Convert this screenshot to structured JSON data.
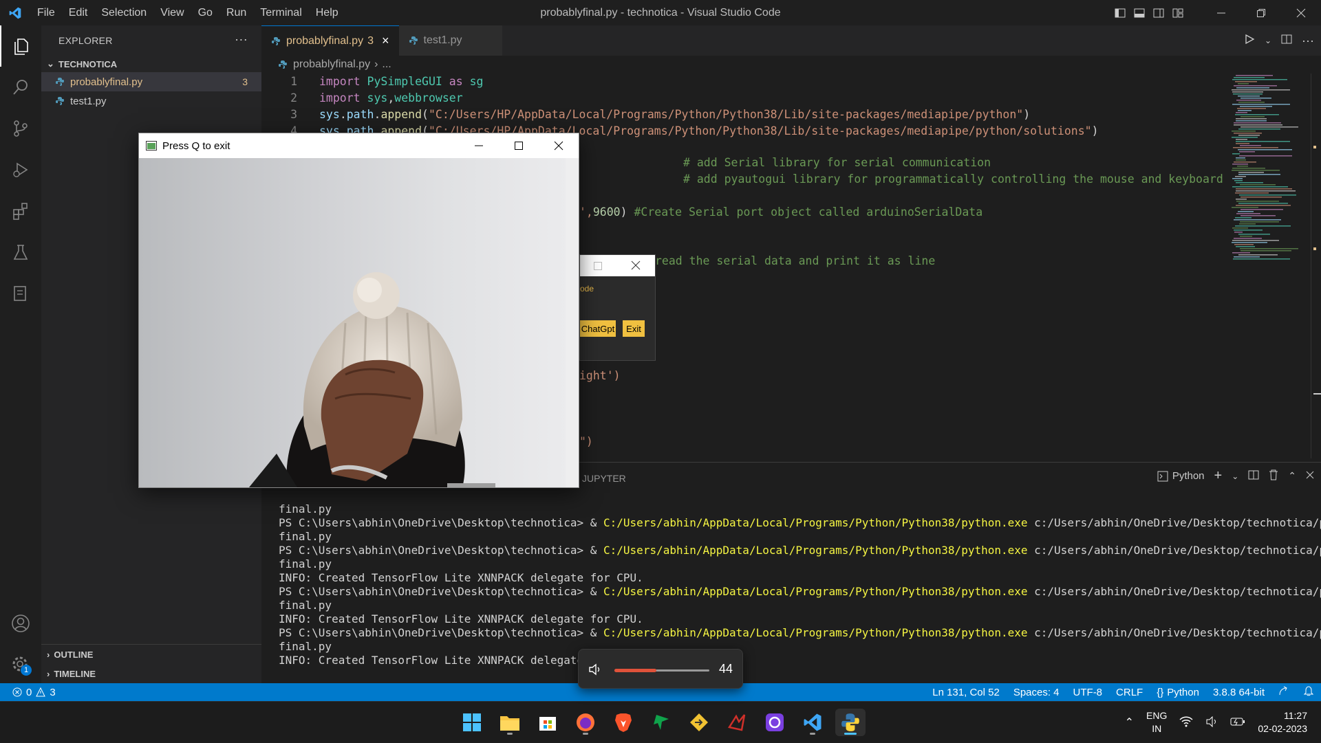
{
  "window": {
    "title": "probablyfinal.py - technotica - Visual Studio Code",
    "menu": [
      "File",
      "Edit",
      "Selection",
      "View",
      "Go",
      "Run",
      "Terminal",
      "Help"
    ]
  },
  "sidebar": {
    "header": "EXPLORER",
    "folder": "TECHNOTICA",
    "files": [
      {
        "name": "probablyfinal.py",
        "badge": "3"
      },
      {
        "name": "test1.py",
        "badge": ""
      }
    ],
    "outline": "OUTLINE",
    "timeline": "TIMELINE"
  },
  "tabs": [
    {
      "label": "probablyfinal.py",
      "badge": "3"
    },
    {
      "label": "test1.py"
    }
  ],
  "breadcrumb": {
    "file": "probablyfinal.py",
    "rest": "..."
  },
  "editor": {
    "lines": [
      {
        "n": "1",
        "parts": [
          [
            "kw",
            "import "
          ],
          [
            "mod",
            "PySimpleGUI "
          ],
          [
            "kw",
            "as "
          ],
          [
            "mod",
            "sg"
          ]
        ]
      },
      {
        "n": "2",
        "parts": [
          [
            "kw",
            "import "
          ],
          [
            "mod",
            "sys"
          ],
          [
            "pl",
            ","
          ],
          [
            "mod",
            "webbrowser"
          ]
        ]
      },
      {
        "n": "3",
        "parts": [
          [
            "var",
            "sys"
          ],
          [
            "pl",
            "."
          ],
          [
            "var",
            "path"
          ],
          [
            "pl",
            "."
          ],
          [
            "fn",
            "append"
          ],
          [
            "pl",
            "("
          ],
          [
            "str",
            "\"C:/Users/HP/AppData/Local/Programs/Python/Python38/Lib/site-packages/mediapipe/python\""
          ],
          [
            "pl",
            ")"
          ]
        ]
      },
      {
        "n": "4",
        "parts": [
          [
            "var",
            "sys"
          ],
          [
            "pl",
            "."
          ],
          [
            "var",
            "path"
          ],
          [
            "pl",
            "."
          ],
          [
            "fn",
            "append"
          ],
          [
            "pl",
            "("
          ],
          [
            "str",
            "\"C:/Users/HP/AppData/Local/Programs/Python/Python38/Lib/site-packages/mediapipe/python/solutions\""
          ],
          [
            "pl",
            ")"
          ]
        ]
      }
    ],
    "fragments": {
      "c1": "# add Serial library for serial communication",
      "c2": "# add pyautogui library for programmatically controlling the mouse and keyboard.",
      "l3a": "',",
      "l3b": "9600",
      "l3c": ") ",
      "l3d": "#Create Serial port object called arduinoSerialData",
      "l4": "read the serial data and print it as line",
      "l5": "ight')",
      "l6": "\")"
    }
  },
  "panel": {
    "tab": "JUPYTER",
    "shell": "Python",
    "terminal": [
      [
        [
          "pl",
          "final.py"
        ]
      ],
      [
        [
          "pl",
          "PS C:\\Users\\abhin\\OneDrive\\Desktop\\technotica> & "
        ],
        [
          "yel",
          "C:/Users/abhin/AppData/Local/Programs/Python/Python38/python.exe"
        ],
        [
          "pl",
          " c:/Users/abhin/OneDrive/Desktop/technotica/probably"
        ]
      ],
      [
        [
          "pl",
          "final.py"
        ]
      ],
      [
        [
          "pl",
          "PS C:\\Users\\abhin\\OneDrive\\Desktop\\technotica> & "
        ],
        [
          "yel",
          "C:/Users/abhin/AppData/Local/Programs/Python/Python38/python.exe"
        ],
        [
          "pl",
          " c:/Users/abhin/OneDrive/Desktop/technotica/probably"
        ]
      ],
      [
        [
          "pl",
          "final.py"
        ]
      ],
      [
        [
          "pl",
          "INFO: Created TensorFlow Lite XNNPACK delegate for CPU."
        ]
      ],
      [
        [
          "pl",
          "PS C:\\Users\\abhin\\OneDrive\\Desktop\\technotica> & "
        ],
        [
          "yel",
          "C:/Users/abhin/AppData/Local/Programs/Python/Python38/python.exe"
        ],
        [
          "pl",
          " c:/Users/abhin/OneDrive/Desktop/technotica/probably"
        ]
      ],
      [
        [
          "pl",
          "final.py"
        ]
      ],
      [
        [
          "pl",
          "INFO: Created TensorFlow Lite XNNPACK delegate for CPU."
        ]
      ],
      [
        [
          "pl",
          "PS C:\\Users\\abhin\\OneDrive\\Desktop\\technotica> & "
        ],
        [
          "yel",
          "C:/Users/abhin/AppData/Local/Programs/Python/Python38/python.exe"
        ],
        [
          "pl",
          " c:/Users/abhin/OneDrive/Desktop/technotica/probably"
        ]
      ],
      [
        [
          "pl",
          "final.py"
        ]
      ],
      [
        [
          "pl",
          "INFO: Created TensorFlow Lite XNNPACK delegate fo"
        ]
      ]
    ]
  },
  "status": {
    "errors": "0",
    "warnings": "3",
    "position": "Ln 131, Col 52",
    "spaces": "Spaces: 4",
    "encoding": "UTF-8",
    "eol": "CRLF",
    "language": "Python",
    "interpreter": "3.8.8 64-bit",
    "account_badge": "1"
  },
  "camera_window": {
    "title": "Press Q to exit"
  },
  "psg_window": {
    "text": "ode",
    "btn1": "ChatGpt",
    "btn2": "Exit"
  },
  "volume": {
    "value": "44",
    "level": 0.44
  },
  "taskbar": {
    "lang1": "ENG",
    "lang2": "IN",
    "time": "11:27",
    "date": "02-02-2023"
  },
  "colors": {
    "accent": "#007acc",
    "tab_modified": "#e2c08d",
    "terminal_path": "#f5f543"
  }
}
